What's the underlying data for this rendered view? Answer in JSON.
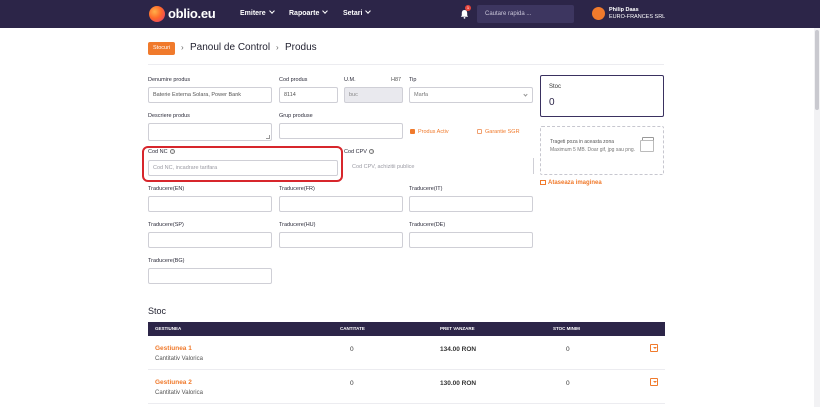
{
  "brand": {
    "name": "oblio.eu"
  },
  "nav": {
    "items": [
      "Emitere",
      "Rapoarte",
      "Setari"
    ],
    "notification_count": "1",
    "search_placeholder": "Cautare rapida ...",
    "user_name": "Philip Daas",
    "user_company": "EURO-FRANCES SRL"
  },
  "breadcrumb": {
    "badge": "Stocuri",
    "items": [
      "Panoul de Control",
      "Produs"
    ]
  },
  "form": {
    "denumire_label": "Denumire produs",
    "denumire_value": "Baterie Externa Solara, Power Bank",
    "cod_label": "Cod produs",
    "cod_value": "8114",
    "um_label": "U.M.",
    "um_code": "H87",
    "um_value": "buc",
    "tip_label": "Tip",
    "tip_value": "Marfa",
    "descriere_label": "Descriere produs",
    "grup_label": "Grup produse",
    "produs_activ": "Produs Activ",
    "garantie": "Garantie SGR",
    "cod_nc_label": "Cod NC",
    "cod_nc_placeholder": "Cod NC, incadrare tarifara",
    "cod_cpv_label": "Cod CPV",
    "cod_cpv_placeholder": "Cod CPV, achizitii publice",
    "translations": [
      "Traducere(EN)",
      "Traducere(FR)",
      "Traducere(IT)",
      "Traducere(SP)",
      "Traducere(HU)",
      "Traducere(DE)",
      "Traducere(BG)"
    ]
  },
  "stock_card": {
    "title": "Stoc",
    "value": "0"
  },
  "dropzone": {
    "line1": "Trageti poza in aceasta zona",
    "line2": "Maximum 5 MB. Doar gif, jpg sau png."
  },
  "attach_image": "Ataseaza imaginea",
  "stoc": {
    "title": "Stoc",
    "columns": [
      "GESTIUNEA",
      "CANTITATE",
      "PRET VANZARE",
      "STOC MINIM"
    ],
    "rows": [
      {
        "name": "Gestiunea 1",
        "sub": "Cantitativ Valorica",
        "qty": "0",
        "price": "134.00 RON",
        "min": "0"
      },
      {
        "name": "Gestiunea 2",
        "sub": "Cantitativ Valorica",
        "qty": "0",
        "price": "130.00 RON",
        "min": "0"
      }
    ]
  },
  "colors": {
    "nav": "#2c2548",
    "accent": "#f07a2c",
    "highlight": "#d7262c"
  }
}
